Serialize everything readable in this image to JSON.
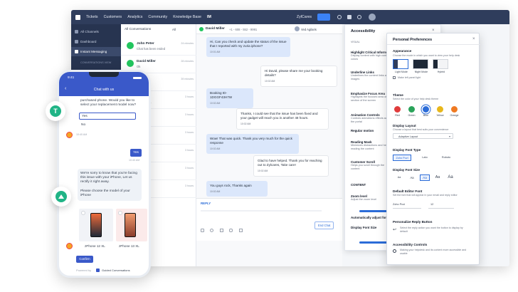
{
  "topbar": {
    "nav": [
      "Tickets",
      "Customers",
      "Analytics",
      "Community",
      "Knowledge Base",
      "IM"
    ],
    "brand": "ZylCares"
  },
  "sidebar": {
    "items": [
      "All Channels",
      "Dashboard",
      "Instant Messaging",
      "CONVERSATIONS VIEW"
    ]
  },
  "conversations": {
    "header": "All Conversations",
    "filter": "All",
    "rows": [
      {
        "name": "John Peter",
        "msg": "Chat has been ended",
        "time": "24 minutes"
      },
      {
        "name": "David Miller",
        "msg": "Ok",
        "time": "28 minutes"
      },
      {
        "name": "",
        "msg": "",
        "time": "39 minutes"
      },
      {
        "name": "",
        "msg": "comment...",
        "time": "3 hours"
      },
      {
        "name": "",
        "msg": "",
        "time": "3 hours"
      },
      {
        "name": "",
        "msg": "to login",
        "time": "3 hours"
      },
      {
        "name": "",
        "msg": "ended",
        "time": "3 hours"
      },
      {
        "name": "",
        "msg": "ended",
        "time": "3 hours"
      },
      {
        "name": "",
        "msg": "",
        "time": "3 hours"
      }
    ]
  },
  "chat": {
    "contact": "David Miller",
    "phone": "+1 - 608 - 552 - 9991",
    "agent": "Ved Agilaris",
    "messages": [
      {
        "text": "Hi, Can you check and update the status of the issue that I reported with my zuria iphone?",
        "time": "10:01 AM",
        "dir": "in"
      },
      {
        "text": "Hi David, please share me your booking details?",
        "time": "10:02 AM",
        "dir": "out"
      },
      {
        "text": "Booking ID- 1DGGF43H7W",
        "time": "10:02 AM",
        "dir": "in"
      },
      {
        "text": "Thanks, I could see that the issue has been fixed and your gadget will reach you in another 48 hours.",
        "time": "10:02 AM",
        "dir": "out"
      },
      {
        "text": "Wow! That was quick. Thank you very much for the quick response",
        "time": "10:02 AM",
        "dir": "in"
      },
      {
        "text": "Glad to have helped. Thank you for reaching out to Zylcares, Take care!",
        "time": "10:02 AM",
        "dir": "out"
      },
      {
        "text": "You guys rock, Thanks again",
        "time": "10:02 AM",
        "dir": "in"
      }
    ],
    "reply_tab": "REPLY",
    "end_button": "End Chat"
  },
  "accessibility": {
    "title": "Accessibility",
    "visual": "VISUAL",
    "sections": [
      {
        "h": "Highlight Critical Inform",
        "s": "Display content with high contrast colors"
      },
      {
        "h": "Underline Links",
        "s": "Underlines the content links and images"
      },
      {
        "h": "Emphasize Focus Area",
        "s": "Highlights the focused area or section of the screen"
      },
      {
        "h": "Animation Controls",
        "s": "Controls animations effects across the portal"
      },
      {
        "h": "Regular motion",
        "s": ""
      },
      {
        "h": "Reading Mask",
        "s": "Minimizes distractions and helps reading the content"
      },
      {
        "h": "Customer Scroll",
        "s": "Helps you scroll through the content"
      },
      {
        "h": "CONTENT",
        "s": ""
      },
      {
        "h": "Zoom level",
        "s": "Adjust the zoom level"
      },
      {
        "h": "Automatically adjust font",
        "s": ""
      },
      {
        "h": "Display Font Size",
        "s": ""
      }
    ]
  },
  "prefs": {
    "title": "Personal Preferences",
    "appearance": "Appearance",
    "appearance_sub": "Choose the mode in which you want to view your help desk",
    "modes": [
      "Light Mode",
      "Night Mode",
      "Hybrid"
    ],
    "panel_toggle": "Make left panel light",
    "theme": "Theme",
    "theme_sub": "Select the color of your help desk theme",
    "themes": [
      {
        "name": "Red",
        "color": "#e03c3c"
      },
      {
        "name": "Green",
        "color": "#2aa35a"
      },
      {
        "name": "Blue",
        "color": "#2b6cd8"
      },
      {
        "name": "Yellow",
        "color": "#e8b71a"
      },
      {
        "name": "Orange",
        "color": "#ef7a22"
      }
    ],
    "layout": "Display Layout",
    "layout_sub": "Choose a layout that best suits your convenience",
    "layout_value": "Adaptive Layout",
    "font_type": "Display Font Type",
    "fonts": [
      "Zoho Puvi",
      "Lato",
      "Roboto"
    ],
    "font_size": "Display Font Size",
    "sizes": [
      "Aa",
      "Aa",
      "Aa",
      "Aa",
      "Aa"
    ],
    "default_font": "Default Editor Font",
    "default_font_sub": "Set the font that will appear in your email and reply editor",
    "default_font_value": "Zoho Puvi",
    "default_font_size": "12",
    "reply_button": "Personalize Reply Button",
    "reply_button_sub": "Select the reply action you want the button to display by default",
    "acc_controls": "Accessibility Controls",
    "acc_controls_sub": "Making your helpdesk and its content more accessible and usable"
  },
  "phone": {
    "time": "9:41",
    "header": "Chat with us",
    "msg1": "purchased phone. Would you like to select your replacement model now?",
    "opt_yes": "Yes",
    "opt_no": "No",
    "t1": "10:40 AM",
    "yes_reply": "Yes",
    "t2": "10:40 AM",
    "msg2": "We're sorry to know that you're facing this issue with your iPhone, Let us rectify it right away.",
    "msg3": "Please choose the model of your iPhone",
    "product1": "zPhone 12 XL",
    "product2": "zPhone 13 XL",
    "confirm": "Confirm",
    "powered": "Powered by",
    "powered_name": "Guided Conversations"
  }
}
